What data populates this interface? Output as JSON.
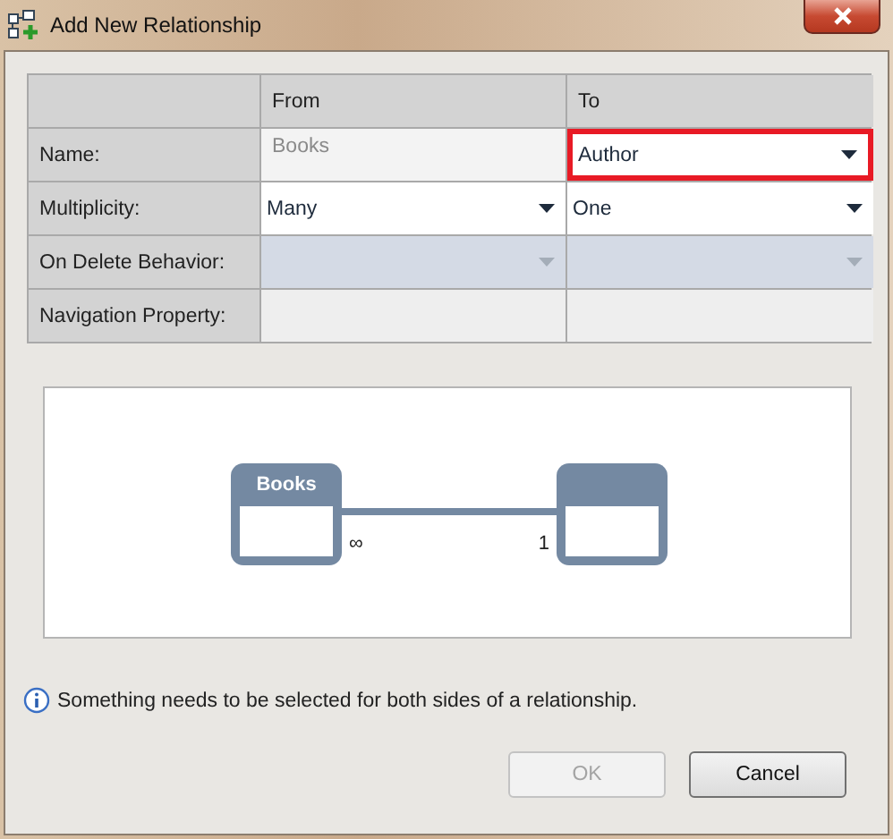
{
  "window": {
    "title": "Add New Relationship"
  },
  "table": {
    "columns": [
      "From",
      "To"
    ],
    "rows": [
      {
        "label": "Name:",
        "cells": [
          {
            "kind": "readonly",
            "value": "Books",
            "highlighted": false
          },
          {
            "kind": "dropdown",
            "value": "Author",
            "highlighted": true
          }
        ]
      },
      {
        "label": "Multiplicity:",
        "cells": [
          {
            "kind": "dropdown",
            "value": "Many",
            "highlighted": false
          },
          {
            "kind": "dropdown",
            "value": "One",
            "highlighted": false
          }
        ]
      },
      {
        "label": "On Delete Behavior:",
        "cells": [
          {
            "kind": "disabled-dropdown",
            "highlighted": false
          },
          {
            "kind": "disabled-dropdown",
            "highlighted": false
          }
        ]
      },
      {
        "label": "Navigation Property:",
        "cells": [
          {
            "kind": "empty",
            "highlighted": false
          },
          {
            "kind": "empty",
            "highlighted": false
          }
        ]
      }
    ]
  },
  "diagram": {
    "from_entity": "Books",
    "from_multiplicity": "∞",
    "to_multiplicity": "1"
  },
  "message": "Something needs to be selected for both sides of a relationship.",
  "buttons": [
    {
      "label": "OK",
      "disabled": true
    },
    {
      "label": "Cancel",
      "disabled": false
    }
  ]
}
